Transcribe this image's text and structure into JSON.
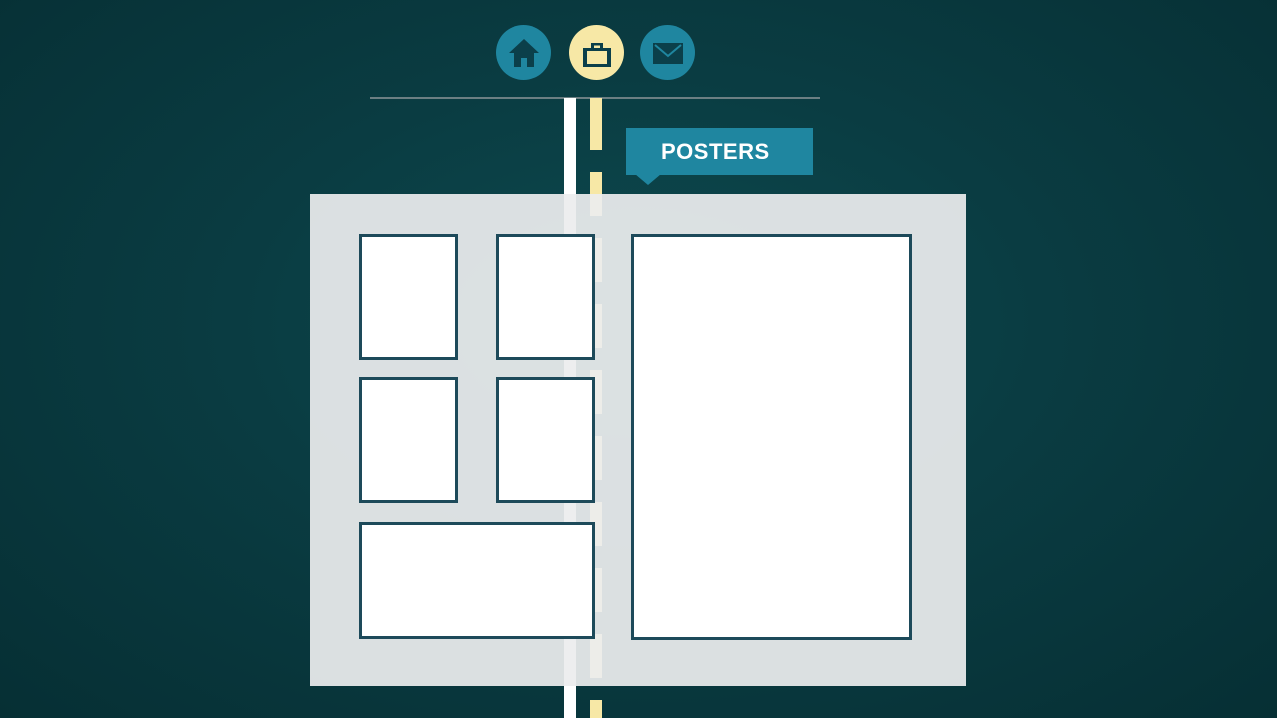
{
  "nav": {
    "items": [
      {
        "icon": "home-icon",
        "active": false
      },
      {
        "icon": "briefcase-icon",
        "active": true
      },
      {
        "icon": "envelope-icon",
        "active": false
      }
    ]
  },
  "section": {
    "tag_label": "POSTERS"
  },
  "colors": {
    "background": "#0a3c42",
    "accent": "#1f86a0",
    "active": "#f7e8a6",
    "board": "#ecedee",
    "frame_border": "#1d4a5a"
  }
}
